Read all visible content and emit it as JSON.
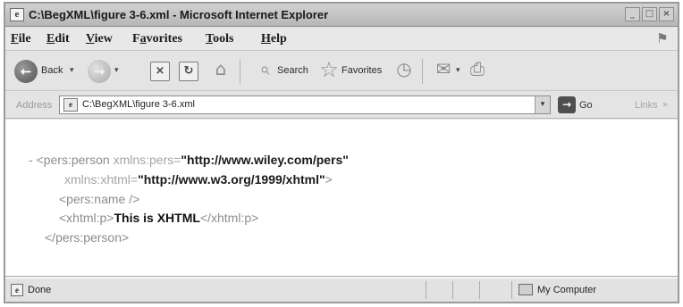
{
  "window": {
    "title": "C:\\BegXML\\figure 3-6.xml - Microsoft Internet Explorer",
    "controls": {
      "minimize": "_",
      "maximize": "□",
      "close": "×"
    }
  },
  "menu": {
    "items": [
      {
        "underline": "F",
        "rest": "ile"
      },
      {
        "underline": "E",
        "rest": "dit"
      },
      {
        "underline": "V",
        "rest": "iew"
      },
      {
        "pre": "F",
        "underline": "a",
        "rest": "vorites"
      },
      {
        "underline": "T",
        "rest": "ools"
      },
      {
        "underline": "H",
        "rest": "elp"
      }
    ]
  },
  "toolbar": {
    "back_label": "Back",
    "search_label": "Search",
    "favorites_label": "Favorites",
    "icons": {
      "back": "←",
      "forward": "→",
      "stop": "×",
      "refresh": "↻",
      "home": "⌂",
      "search": "⌕",
      "favorites": "☆",
      "history": "◷",
      "mail": "✉",
      "print": "⎙",
      "caret": "▾"
    }
  },
  "address": {
    "label": "Address",
    "value": "C:\\BegXML\\figure 3-6.xml",
    "go_label": "Go",
    "links_label": "Links",
    "links_caret": "»"
  },
  "xml": {
    "collapse": "-",
    "line1": {
      "open": "<pers:person",
      "attr": "xmlns:pers=",
      "value": "\"http://www.wiley.com/pers\""
    },
    "line2": {
      "attr": "xmlns:xhtml=",
      "value": "\"http://www.w3.org/1999/xhtml\"",
      "close": ">"
    },
    "line3": {
      "tag": "<pers:name />"
    },
    "line4": {
      "open": "<xhtml:p>",
      "text": "This is XHTML",
      "close": "</xhtml:p>"
    },
    "line5": {
      "tag": "</pers:person>"
    }
  },
  "status": {
    "text": "Done",
    "zone": "My Computer"
  }
}
